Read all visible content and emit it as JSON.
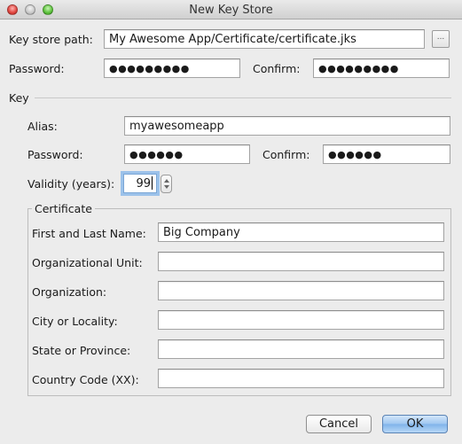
{
  "window": {
    "title": "New Key Store"
  },
  "keystore": {
    "path_label": "Key store path:",
    "path_value": "My Awesome App/Certificate/certificate.jks",
    "browse_label": "...",
    "password_label": "Password:",
    "password_value": "●●●●●●●●●",
    "confirm_label": "Confirm:",
    "confirm_value": "●●●●●●●●●"
  },
  "key": {
    "section_label": "Key",
    "alias_label": "Alias:",
    "alias_value": "myawesomeapp",
    "password_label": "Password:",
    "password_value": "●●●●●●",
    "confirm_label": "Confirm:",
    "confirm_value": "●●●●●●",
    "validity_label": "Validity (years):",
    "validity_value": "99"
  },
  "certificate": {
    "group_label": "Certificate",
    "fields": [
      {
        "label": "First and Last Name:",
        "value": "Big Company"
      },
      {
        "label": "Organizational Unit:",
        "value": ""
      },
      {
        "label": "Organization:",
        "value": ""
      },
      {
        "label": "City or Locality:",
        "value": ""
      },
      {
        "label": "State or Province:",
        "value": ""
      },
      {
        "label": "Country Code (XX):",
        "value": ""
      }
    ]
  },
  "buttons": {
    "cancel": "Cancel",
    "ok": "OK"
  }
}
